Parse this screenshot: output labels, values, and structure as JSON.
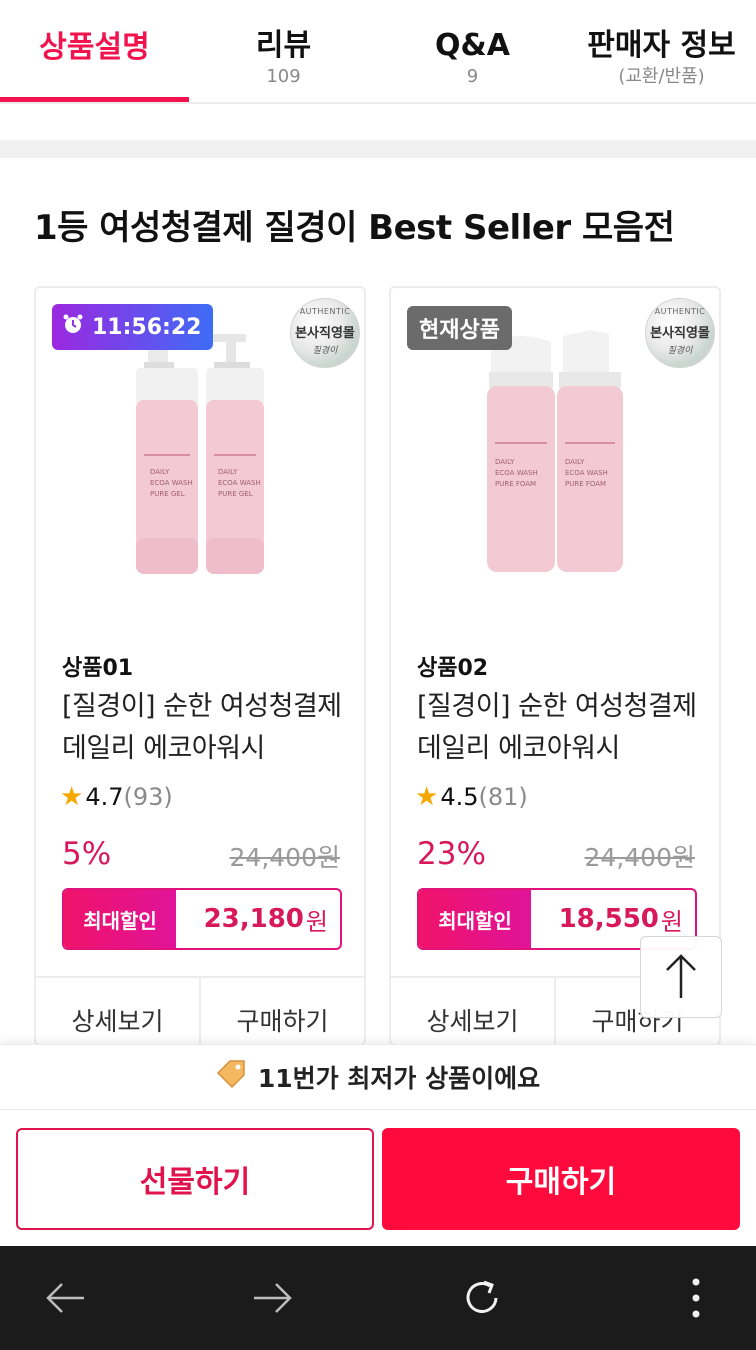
{
  "tabs": [
    {
      "label": "상품설명",
      "sub": ""
    },
    {
      "label": "리뷰",
      "sub": "109"
    },
    {
      "label": "Q&A",
      "sub": "9"
    },
    {
      "label": "판매자 정보",
      "sub": "(교환/반품)"
    }
  ],
  "section": {
    "title": "1등 여성청결제 질경이 Best Seller 모음전"
  },
  "products": [
    {
      "badge": "11:56:22",
      "badge_type": "timer",
      "seal": {
        "top": "AUTHENTIC",
        "main": "본사직영몰",
        "brand": "질경이"
      },
      "image_labels": [
        "DAILY",
        "ECOA WASH",
        "PURE GEL"
      ],
      "name": "상품01",
      "desc": "[질경이] 순한 여성청결제 데일리 에코아워시",
      "rating": "4.7",
      "review_count": "(93)",
      "discount": "5%",
      "original_price": "24,400원",
      "max_label": "최대할인",
      "max_price": "23,180",
      "won": "원",
      "detail_label": "상세보기",
      "buy_label": "구매하기"
    },
    {
      "badge": "현재상품",
      "badge_type": "current",
      "seal": {
        "top": "AUTHENTIC",
        "main": "본사직영몰",
        "brand": "질경이"
      },
      "image_labels": [
        "DAILY",
        "ECOA WASH",
        "PURE FOAM"
      ],
      "name": "상품02",
      "desc": "[질경이] 순한 여성청결제 데일리 에코아워시",
      "rating": "4.5",
      "review_count": "(81)",
      "discount": "23%",
      "original_price": "24,400원",
      "max_label": "최대할인",
      "max_price": "18,550",
      "won": "원",
      "detail_label": "상세보기",
      "buy_label": "구매하기"
    }
  ],
  "lowest_banner": {
    "icon": "price-tag-icon",
    "text": "11번가 최저가 상품이에요"
  },
  "bottom": {
    "gift_label": "선물하기",
    "buy_label": "구매하기"
  },
  "colors": {
    "accent": "#f0134d",
    "buy": "#ff0a3c",
    "price": "#d7195a",
    "timer_from": "#9b28e0",
    "timer_to": "#3e6cf6"
  }
}
